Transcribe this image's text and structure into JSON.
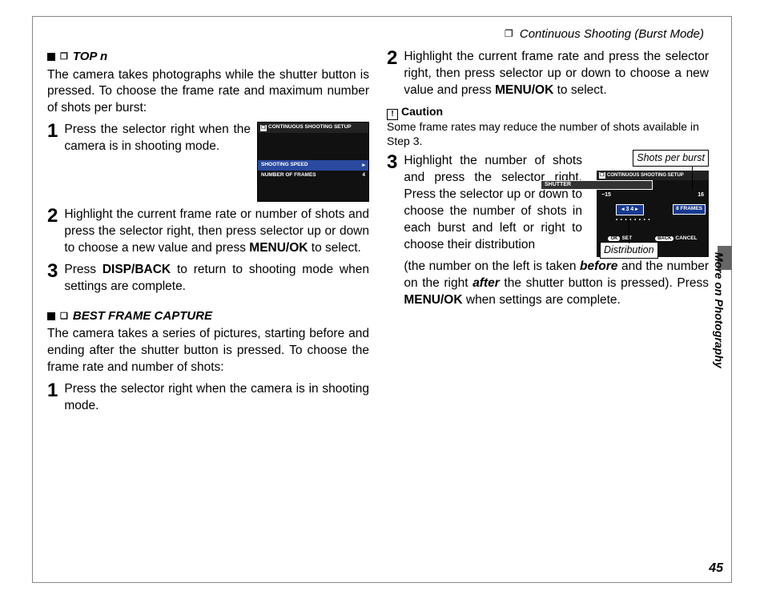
{
  "header": {
    "icon": "❐",
    "title": "Continuous Shooting (Burst Mode)"
  },
  "side_tab": "More on Photography",
  "page_number": "45",
  "left": {
    "sec1": {
      "icon": "❐",
      "title": "TOP n",
      "intro": "The camera takes photographs while the shutter button is pressed.  To choose the frame rate and maximum number of shots per burst:"
    },
    "step1": {
      "num": "1",
      "text": "Press the selector right when the camera is in shooting mode."
    },
    "cam": {
      "title": "CONTINUOUS SHOOTING SETUP",
      "row1_label": "SHOOTING SPEED",
      "row1_val": "▸",
      "row2_label": "NUMBER OF FRAMES",
      "row2_val": "4"
    },
    "step2": {
      "num": "2",
      "text_a": "Highlight the current frame rate or number of shots and press the selector right, then press selector up or down to choose a new value and press ",
      "bold": "MENU/OK",
      "text_b": " to select."
    },
    "step3": {
      "num": "3",
      "text_a": "Press ",
      "bold": "DISP/BACK",
      "text_b": " to return to shooting mode when settings are complete."
    },
    "sec2": {
      "icon": "❏",
      "title": "BEST FRAME CAPTURE",
      "intro": "The camera takes a series of pictures, starting before and ending after the shutter button is pressed.  To choose the frame rate and number of shots:"
    },
    "stepB1": {
      "num": "1",
      "text": "Press the selector right when the camera is in shooting mode."
    }
  },
  "right": {
    "step2": {
      "num": "2",
      "text_a": "Highlight the current frame rate and press the selector right, then press selector up or down to choose a new value and press ",
      "bold": "MENU/OK",
      "text_b": " to select."
    },
    "caution": {
      "head": "Caution",
      "body": "Some frame rates may reduce the number of shots available in Step 3."
    },
    "step3": {
      "num": "3",
      "text_a": "Highlight the number of shots and press the selector right.  Press the selector up or down to choose the number of shots in each burst and left or right to choose their distribution (the number on the left is taken ",
      "bold1": "before",
      "text_b": " and the number on the right ",
      "bold2": "after",
      "text_c": " the shutter button is pressed).   Press ",
      "bold3": "MENU/OK",
      "text_d": " when settings are complete."
    },
    "callouts": {
      "top": "Shots per burst",
      "bottom": "Distribution"
    },
    "cam2": {
      "title": "CONTINUOUS SHOOTING SETUP",
      "shutter": "SHUTTER",
      "minus": "−15",
      "plus": "16",
      "sel": "◂ 3 4 ▸",
      "frames": "8 FRAMES",
      "set": "SET",
      "cancel": "CANCEL",
      "ok": "OK",
      "back": "BACK"
    }
  }
}
